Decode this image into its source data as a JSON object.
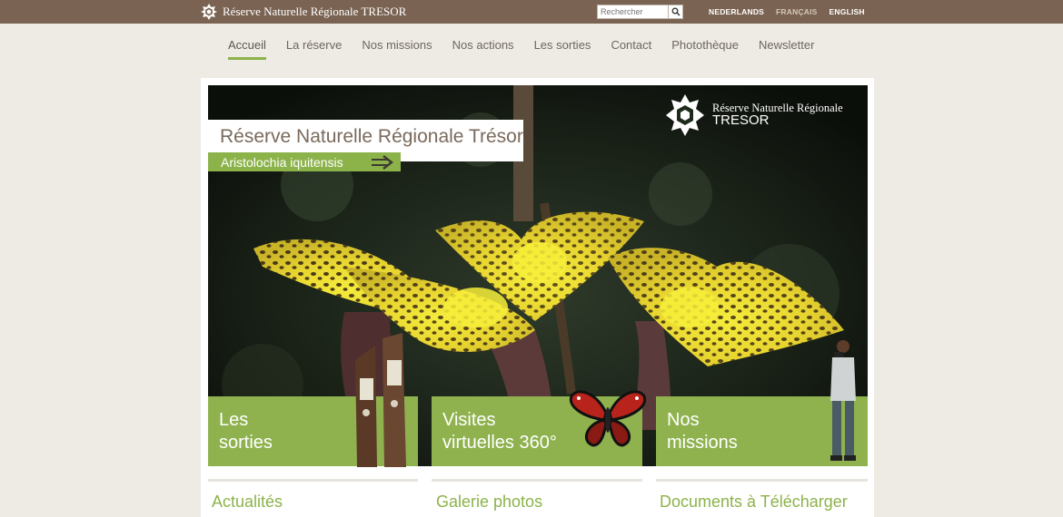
{
  "header": {
    "site_title": "Réserve Naturelle Régionale TRESOR",
    "search_placeholder": "Rechercher",
    "languages": [
      {
        "label": "NEDERLANDS",
        "active": false
      },
      {
        "label": "FRANÇAIS",
        "active": true
      },
      {
        "label": "ENGLISH",
        "active": false
      }
    ]
  },
  "nav": {
    "items": [
      {
        "label": "Accueil",
        "active": true
      },
      {
        "label": "La réserve"
      },
      {
        "label": "Nos missions"
      },
      {
        "label": "Nos actions"
      },
      {
        "label": "Les sorties"
      },
      {
        "label": "Contact"
      },
      {
        "label": "Photothèque"
      },
      {
        "label": "Newsletter"
      }
    ]
  },
  "hero": {
    "title": "Réserve Naturelle Régionale Trésor",
    "caption": "Aristolochia iquitensis",
    "logo_line1": "Réserve Naturelle Régionale",
    "logo_line2": "TRESOR"
  },
  "tiles": [
    {
      "line1": "Les",
      "line2": "sorties"
    },
    {
      "line1": "Visites",
      "line2": "virtuelles 360°"
    },
    {
      "line1": "Nos",
      "line2": "missions"
    }
  ],
  "columns": [
    {
      "title": "Actualités"
    },
    {
      "title": "Galerie photos"
    },
    {
      "title": "Documents à Télécharger"
    }
  ],
  "colors": {
    "topbar": "#7a6352",
    "accent_green": "#8cb34a",
    "background": "#eeebe4"
  },
  "icons": [
    "tresor-star-logo",
    "search-icon",
    "arrow-right-icon"
  ]
}
